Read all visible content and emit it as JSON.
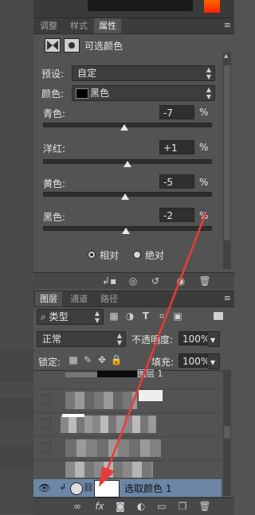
{
  "colors": {
    "panel_bg": "#535353",
    "dark_bg": "#3c3c3c",
    "accent_red": "#ea3b3b",
    "selected_row": "#6b86a6"
  },
  "properties_panel": {
    "tabs": [
      {
        "label": "调整"
      },
      {
        "label": "样式"
      },
      {
        "label": "属性"
      }
    ],
    "active_tab": "属性",
    "title": "可选颜色",
    "preset_label": "预设:",
    "preset_value": "自定",
    "color_label": "颜色:",
    "color_value": "黑色",
    "sliders": [
      {
        "label": "青色:",
        "value": "-7",
        "unit": "%",
        "position": 0.485
      },
      {
        "label": "洋红:",
        "value": "+1",
        "unit": "%",
        "position": 0.505
      },
      {
        "label": "黄色:",
        "value": "-5",
        "unit": "%",
        "position": 0.49
      },
      {
        "label": "黑色:",
        "value": "-2",
        "unit": "%",
        "position": 0.495
      }
    ],
    "radio_relative": "相对",
    "radio_absolute": "绝对",
    "radio_selected": "相对",
    "footer_icons": [
      "clip-to-layer-icon",
      "view-previous-icon",
      "reset-icon",
      "visibility-icon",
      "delete-icon"
    ]
  },
  "layers_panel": {
    "tabs": [
      {
        "label": "图层"
      },
      {
        "label": "通道"
      },
      {
        "label": "路径"
      }
    ],
    "active_tab": "图层",
    "filter_label": "类型",
    "blend_mode": "正常",
    "opacity_label": "不透明度:",
    "opacity_value": "100%",
    "lock_label": "锁定:",
    "fill_label": "填充:",
    "fill_value": "100%",
    "partial_layer_name": "图层 1",
    "selected_layer_name": "选取颜色 1",
    "footer_icons": [
      "link-icon",
      "fx-icon",
      "mask-icon",
      "adjustment-icon",
      "group-icon",
      "new-layer-icon",
      "delete-icon"
    ]
  }
}
